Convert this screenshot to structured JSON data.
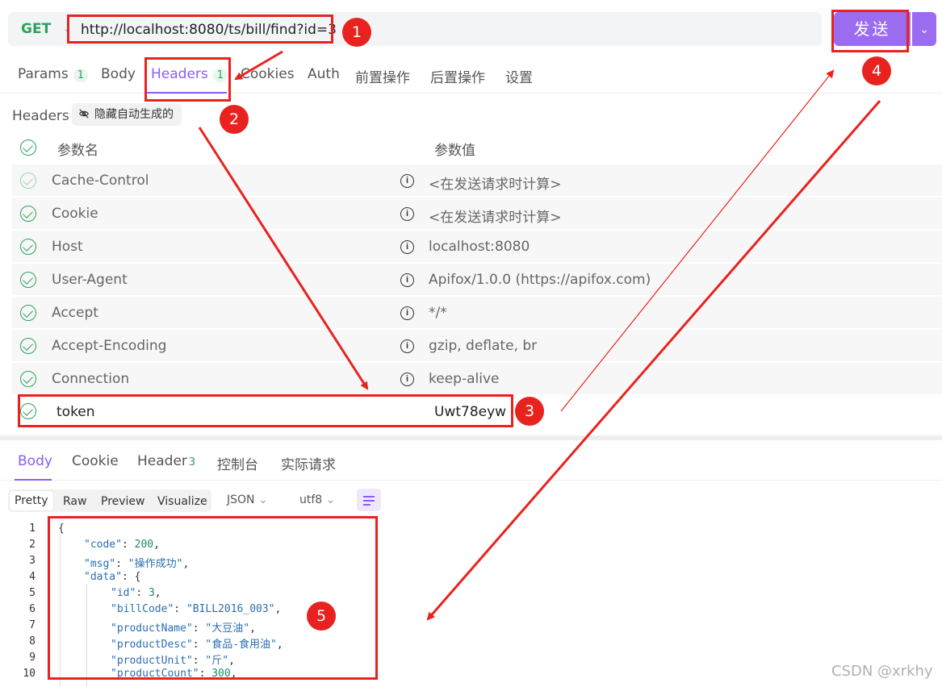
{
  "request": {
    "method": "GET",
    "url": "http://localhost:8080/ts/bill/find?id=3",
    "send_label": "发送"
  },
  "request_tabs": [
    {
      "label": "Params",
      "count": "1"
    },
    {
      "label": "Body"
    },
    {
      "label": "Headers",
      "count": "1"
    },
    {
      "label": "Cookies"
    },
    {
      "label": "Auth"
    },
    {
      "label": "前置操作"
    },
    {
      "label": "后置操作"
    },
    {
      "label": "设置"
    }
  ],
  "headers_section": {
    "title": "Headers",
    "hide_auto_label": "隐藏自动生成的",
    "col_name": "参数名",
    "col_value": "参数值",
    "rows": [
      {
        "key": "Cache-Control",
        "value": "<在发送请求时计算>"
      },
      {
        "key": "Cookie",
        "value": "<在发送请求时计算>"
      },
      {
        "key": "Host",
        "value": "localhost:8080"
      },
      {
        "key": "User-Agent",
        "value": "Apifox/1.0.0 (https://apifox.com)"
      },
      {
        "key": "Accept",
        "value": "*/*"
      },
      {
        "key": "Accept-Encoding",
        "value": "gzip, deflate, br"
      },
      {
        "key": "Connection",
        "value": "keep-alive"
      }
    ],
    "custom_row": {
      "key": "token",
      "value": "Uwt78eyw"
    }
  },
  "response_tabs": [
    {
      "label": "Body"
    },
    {
      "label": "Cookie"
    },
    {
      "label": "Header",
      "count": "3"
    },
    {
      "label": "控制台"
    },
    {
      "label": "实际请求"
    }
  ],
  "view_modes": [
    "Pretty",
    "Raw",
    "Preview",
    "Visualize"
  ],
  "format_select": "JSON",
  "encoding_select": "utf8",
  "code_lines": [
    {
      "n": "1",
      "text": "{"
    },
    {
      "n": "2",
      "key": "\"code\"",
      "rest": ": ",
      "num": "200",
      "end": ","
    },
    {
      "n": "3",
      "key": "\"msg\"",
      "rest": ": ",
      "str": "\"操作成功\"",
      "end": ","
    },
    {
      "n": "4",
      "key": "\"data\"",
      "rest": ": {"
    },
    {
      "n": "5",
      "key": "\"id\"",
      "rest": ": ",
      "num": "3",
      "end": ","
    },
    {
      "n": "6",
      "key": "\"billCode\"",
      "rest": ": ",
      "str": "\"BILL2016_003\"",
      "end": ","
    },
    {
      "n": "7",
      "key": "\"productName\"",
      "rest": ": ",
      "str": "\"大豆油\"",
      "end": ","
    },
    {
      "n": "8",
      "key": "\"productDesc\"",
      "rest": ": ",
      "str": "\"食品-食用油\"",
      "end": ","
    },
    {
      "n": "9",
      "key": "\"productUnit\"",
      "rest": ": ",
      "str": "\"斤\"",
      "end": ","
    },
    {
      "n": "10",
      "key": "\"productCount\"",
      "rest": ": ",
      "num": "300",
      "end": ","
    }
  ],
  "annotations": [
    "1",
    "2",
    "3",
    "4",
    "5"
  ],
  "watermark": "CSDN @xrkhy",
  "colors": {
    "accent": "#8b5cf6",
    "send": "#9b6cf0",
    "method": "#2aa35a",
    "annotation": "#e8231f"
  }
}
